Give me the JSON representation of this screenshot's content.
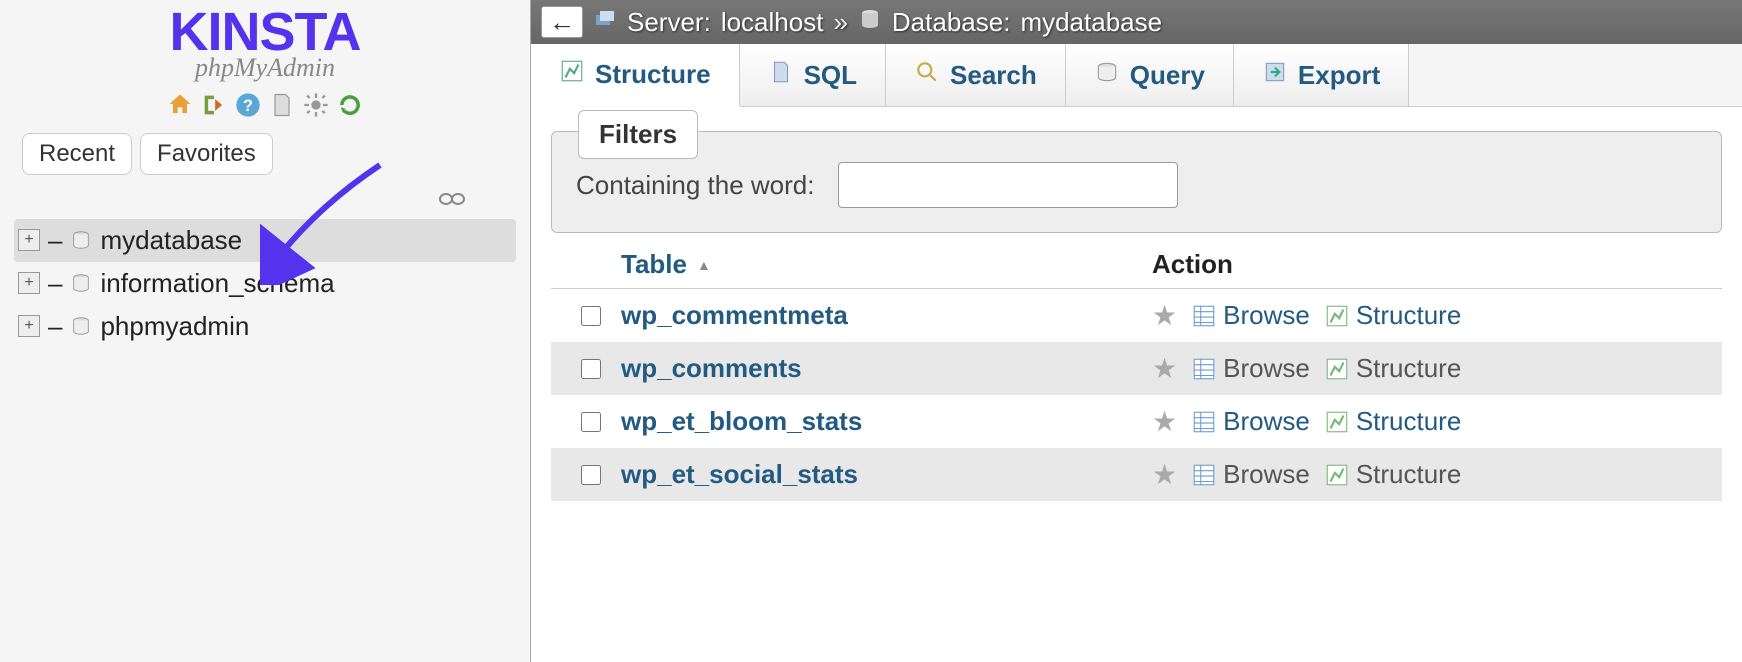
{
  "logo": {
    "brand": "KINSTA",
    "product": "phpMyAdmin"
  },
  "sidebar": {
    "recent": "Recent",
    "favorites": "Favorites",
    "items": [
      {
        "label": "mydatabase",
        "selected": true
      },
      {
        "label": "information_schema",
        "selected": false
      },
      {
        "label": "phpmyadmin",
        "selected": false
      }
    ]
  },
  "breadcrumb": {
    "server_label": "Server:",
    "server_value": "localhost",
    "separator": "»",
    "database_label": "Database:",
    "database_value": "mydatabase"
  },
  "tabs": [
    {
      "label": "Structure",
      "active": true
    },
    {
      "label": "SQL",
      "active": false
    },
    {
      "label": "Search",
      "active": false
    },
    {
      "label": "Query",
      "active": false
    },
    {
      "label": "Export",
      "active": false
    }
  ],
  "filters": {
    "title": "Filters",
    "label": "Containing the word:",
    "value": ""
  },
  "table_header": {
    "name": "Table",
    "action": "Action"
  },
  "action_labels": {
    "browse": "Browse",
    "structure": "Structure"
  },
  "rows": [
    {
      "name": "wp_commentmeta"
    },
    {
      "name": "wp_comments"
    },
    {
      "name": "wp_et_bloom_stats"
    },
    {
      "name": "wp_et_social_stats"
    }
  ],
  "colors": {
    "link": "#235a81",
    "brand": "#5333ed"
  }
}
